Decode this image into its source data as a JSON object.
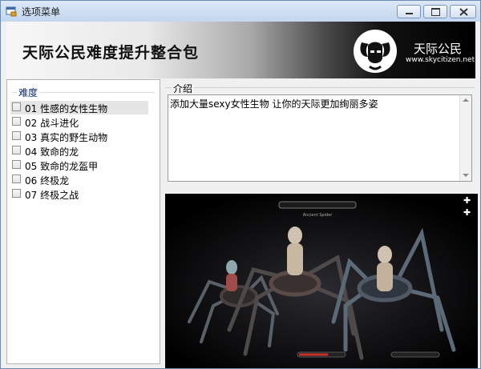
{
  "window": {
    "title": "选项菜单",
    "icons": {
      "app": "app-window-icon",
      "minimize": "minimize-icon",
      "maximize": "maximize-icon",
      "close": "close-icon"
    }
  },
  "banner": {
    "title": "天际公民难度提升整合包",
    "brand_name": "天际公民",
    "brand_url": "www.skycitizen.net",
    "logo_icon": "horned-helmet-logo-icon"
  },
  "difficulty": {
    "title": "难度",
    "options": [
      {
        "label": "01 性感的女性生物",
        "checked": false
      },
      {
        "label": "02 战斗进化",
        "checked": false
      },
      {
        "label": "03 真实的野生动物",
        "checked": false
      },
      {
        "label": "04 致命的龙",
        "checked": false
      },
      {
        "label": "05 致命的龙盔甲",
        "checked": false
      },
      {
        "label": "06 终极龙",
        "checked": false
      },
      {
        "label": "07 终极之战",
        "checked": false
      }
    ]
  },
  "intro": {
    "title": "介绍",
    "text": "添加大量sexy女性生物 让你的天际更加绚丽多姿"
  },
  "preview": {
    "image_icon": "spider-creatures-preview-image",
    "hud_label": "Ancient Spider",
    "health_fraction": 0.65,
    "colors": {
      "health": "#c8322a"
    }
  }
}
